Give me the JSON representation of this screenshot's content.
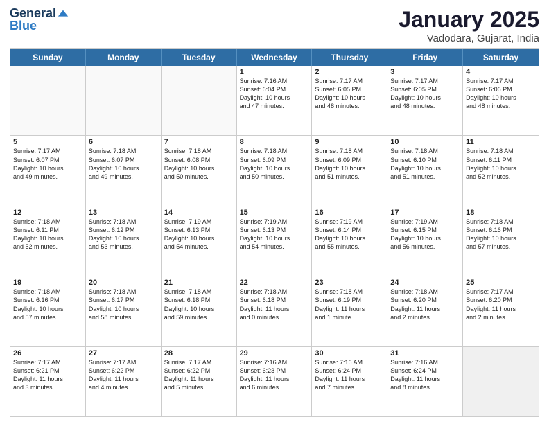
{
  "logo": {
    "line1": "General",
    "line2": "Blue"
  },
  "title": "January 2025",
  "subtitle": "Vadodara, Gujarat, India",
  "days": [
    "Sunday",
    "Monday",
    "Tuesday",
    "Wednesday",
    "Thursday",
    "Friday",
    "Saturday"
  ],
  "weeks": [
    [
      {
        "day": "",
        "empty": true
      },
      {
        "day": "",
        "empty": true
      },
      {
        "day": "",
        "empty": true
      },
      {
        "day": "1",
        "lines": [
          "Sunrise: 7:16 AM",
          "Sunset: 6:04 PM",
          "Daylight: 10 hours",
          "and 47 minutes."
        ]
      },
      {
        "day": "2",
        "lines": [
          "Sunrise: 7:17 AM",
          "Sunset: 6:05 PM",
          "Daylight: 10 hours",
          "and 48 minutes."
        ]
      },
      {
        "day": "3",
        "lines": [
          "Sunrise: 7:17 AM",
          "Sunset: 6:05 PM",
          "Daylight: 10 hours",
          "and 48 minutes."
        ]
      },
      {
        "day": "4",
        "lines": [
          "Sunrise: 7:17 AM",
          "Sunset: 6:06 PM",
          "Daylight: 10 hours",
          "and 48 minutes."
        ]
      }
    ],
    [
      {
        "day": "5",
        "lines": [
          "Sunrise: 7:17 AM",
          "Sunset: 6:07 PM",
          "Daylight: 10 hours",
          "and 49 minutes."
        ]
      },
      {
        "day": "6",
        "lines": [
          "Sunrise: 7:18 AM",
          "Sunset: 6:07 PM",
          "Daylight: 10 hours",
          "and 49 minutes."
        ]
      },
      {
        "day": "7",
        "lines": [
          "Sunrise: 7:18 AM",
          "Sunset: 6:08 PM",
          "Daylight: 10 hours",
          "and 50 minutes."
        ]
      },
      {
        "day": "8",
        "lines": [
          "Sunrise: 7:18 AM",
          "Sunset: 6:09 PM",
          "Daylight: 10 hours",
          "and 50 minutes."
        ]
      },
      {
        "day": "9",
        "lines": [
          "Sunrise: 7:18 AM",
          "Sunset: 6:09 PM",
          "Daylight: 10 hours",
          "and 51 minutes."
        ]
      },
      {
        "day": "10",
        "lines": [
          "Sunrise: 7:18 AM",
          "Sunset: 6:10 PM",
          "Daylight: 10 hours",
          "and 51 minutes."
        ]
      },
      {
        "day": "11",
        "lines": [
          "Sunrise: 7:18 AM",
          "Sunset: 6:11 PM",
          "Daylight: 10 hours",
          "and 52 minutes."
        ]
      }
    ],
    [
      {
        "day": "12",
        "lines": [
          "Sunrise: 7:18 AM",
          "Sunset: 6:11 PM",
          "Daylight: 10 hours",
          "and 52 minutes."
        ]
      },
      {
        "day": "13",
        "lines": [
          "Sunrise: 7:18 AM",
          "Sunset: 6:12 PM",
          "Daylight: 10 hours",
          "and 53 minutes."
        ]
      },
      {
        "day": "14",
        "lines": [
          "Sunrise: 7:19 AM",
          "Sunset: 6:13 PM",
          "Daylight: 10 hours",
          "and 54 minutes."
        ]
      },
      {
        "day": "15",
        "lines": [
          "Sunrise: 7:19 AM",
          "Sunset: 6:13 PM",
          "Daylight: 10 hours",
          "and 54 minutes."
        ]
      },
      {
        "day": "16",
        "lines": [
          "Sunrise: 7:19 AM",
          "Sunset: 6:14 PM",
          "Daylight: 10 hours",
          "and 55 minutes."
        ]
      },
      {
        "day": "17",
        "lines": [
          "Sunrise: 7:19 AM",
          "Sunset: 6:15 PM",
          "Daylight: 10 hours",
          "and 56 minutes."
        ]
      },
      {
        "day": "18",
        "lines": [
          "Sunrise: 7:18 AM",
          "Sunset: 6:16 PM",
          "Daylight: 10 hours",
          "and 57 minutes."
        ]
      }
    ],
    [
      {
        "day": "19",
        "lines": [
          "Sunrise: 7:18 AM",
          "Sunset: 6:16 PM",
          "Daylight: 10 hours",
          "and 57 minutes."
        ]
      },
      {
        "day": "20",
        "lines": [
          "Sunrise: 7:18 AM",
          "Sunset: 6:17 PM",
          "Daylight: 10 hours",
          "and 58 minutes."
        ]
      },
      {
        "day": "21",
        "lines": [
          "Sunrise: 7:18 AM",
          "Sunset: 6:18 PM",
          "Daylight: 10 hours",
          "and 59 minutes."
        ]
      },
      {
        "day": "22",
        "lines": [
          "Sunrise: 7:18 AM",
          "Sunset: 6:18 PM",
          "Daylight: 11 hours",
          "and 0 minutes."
        ]
      },
      {
        "day": "23",
        "lines": [
          "Sunrise: 7:18 AM",
          "Sunset: 6:19 PM",
          "Daylight: 11 hours",
          "and 1 minute."
        ]
      },
      {
        "day": "24",
        "lines": [
          "Sunrise: 7:18 AM",
          "Sunset: 6:20 PM",
          "Daylight: 11 hours",
          "and 2 minutes."
        ]
      },
      {
        "day": "25",
        "lines": [
          "Sunrise: 7:17 AM",
          "Sunset: 6:20 PM",
          "Daylight: 11 hours",
          "and 2 minutes."
        ]
      }
    ],
    [
      {
        "day": "26",
        "lines": [
          "Sunrise: 7:17 AM",
          "Sunset: 6:21 PM",
          "Daylight: 11 hours",
          "and 3 minutes."
        ]
      },
      {
        "day": "27",
        "lines": [
          "Sunrise: 7:17 AM",
          "Sunset: 6:22 PM",
          "Daylight: 11 hours",
          "and 4 minutes."
        ]
      },
      {
        "day": "28",
        "lines": [
          "Sunrise: 7:17 AM",
          "Sunset: 6:22 PM",
          "Daylight: 11 hours",
          "and 5 minutes."
        ]
      },
      {
        "day": "29",
        "lines": [
          "Sunrise: 7:16 AM",
          "Sunset: 6:23 PM",
          "Daylight: 11 hours",
          "and 6 minutes."
        ]
      },
      {
        "day": "30",
        "lines": [
          "Sunrise: 7:16 AM",
          "Sunset: 6:24 PM",
          "Daylight: 11 hours",
          "and 7 minutes."
        ]
      },
      {
        "day": "31",
        "lines": [
          "Sunrise: 7:16 AM",
          "Sunset: 6:24 PM",
          "Daylight: 11 hours",
          "and 8 minutes."
        ]
      },
      {
        "day": "",
        "empty": true,
        "shaded": true
      }
    ]
  ]
}
